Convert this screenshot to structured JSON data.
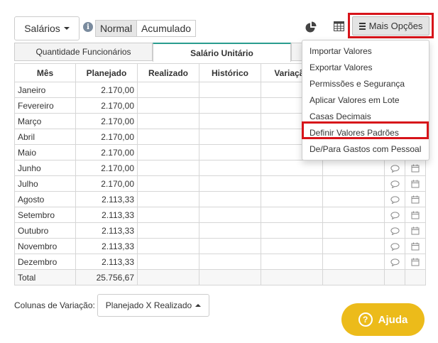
{
  "toolbar": {
    "salarios_label": "Salários",
    "view_modes": [
      "Normal",
      "Acumulado"
    ],
    "selected_view": "Normal",
    "mais_opcoes_label": "Mais Opções"
  },
  "tabs": [
    {
      "label": "Quantidade Funcionários",
      "active": false
    },
    {
      "label": "Salário Unitário",
      "active": true
    }
  ],
  "table": {
    "headers": [
      "Mês",
      "Planejado",
      "Realizado",
      "Histórico",
      "Variação"
    ],
    "rows": [
      {
        "month": "Janeiro",
        "planejado": "2.170,00"
      },
      {
        "month": "Fevereiro",
        "planejado": "2.170,00"
      },
      {
        "month": "Março",
        "planejado": "2.170,00"
      },
      {
        "month": "Abril",
        "planejado": "2.170,00"
      },
      {
        "month": "Maio",
        "planejado": "2.170,00"
      },
      {
        "month": "Junho",
        "planejado": "2.170,00"
      },
      {
        "month": "Julho",
        "planejado": "2.170,00"
      },
      {
        "month": "Agosto",
        "planejado": "2.113,33"
      },
      {
        "month": "Setembro",
        "planejado": "2.113,33"
      },
      {
        "month": "Outubro",
        "planejado": "2.113,33"
      },
      {
        "month": "Novembro",
        "planejado": "2.113,33"
      },
      {
        "month": "Dezembro",
        "planejado": "2.113,33"
      }
    ],
    "total": {
      "label": "Total",
      "planejado": "25.756,67"
    }
  },
  "menu": {
    "items": [
      "Importar Valores",
      "Exportar Valores",
      "Permissões e Segurança",
      "Aplicar Valores em Lote",
      "Casas Decimais",
      "Definir Valores Padrões",
      "De/Para Gastos com Pessoal"
    ],
    "highlighted": "Definir Valores Padrões"
  },
  "footer": {
    "colunas_label": "Colunas de Variação:",
    "variacao_value": "Planejado X Realizado",
    "ajuda_label": "Ajuda"
  },
  "colors": {
    "highlight_border": "#d7141a",
    "active_tab_accent": "#2a9d8f",
    "help_button": "#ecbb1a"
  },
  "icons": [
    "info-icon",
    "pie-chart-icon",
    "table-grid-icon",
    "hamburger-icon",
    "comment-icon",
    "calendar-icon",
    "help-circle-icon"
  ]
}
